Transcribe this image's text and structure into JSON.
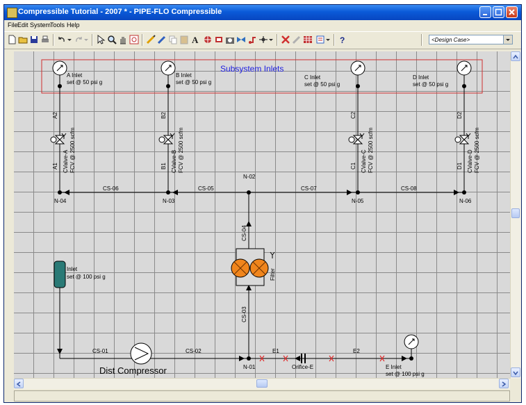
{
  "window": {
    "title": "Compressible Tutorial - 2007 * - PIPE-FLO Compressible"
  },
  "menu": {
    "items": [
      "File",
      "Edit",
      "System",
      "Tools",
      "Help"
    ]
  },
  "toolbar": {
    "design_case": "<Design Case>"
  },
  "diagram": {
    "group_title": "Subsystem Inlets",
    "inlets": [
      {
        "name": "A Inlet",
        "setpoint": "set @ 50 psi g"
      },
      {
        "name": "B Inlet",
        "setpoint": "set @ 50 psi g"
      },
      {
        "name": "C Inlet",
        "setpoint": "set @ 50 psi g"
      },
      {
        "name": "D Inlet",
        "setpoint": "set @ 50 psi g"
      }
    ],
    "valves": [
      {
        "upper_pipe": "A2",
        "lower_pipe": "A1",
        "name": "CValve-A",
        "setting": "FCV @ 2500 scfm"
      },
      {
        "upper_pipe": "B2",
        "lower_pipe": "B1",
        "name": "CValve-B",
        "setting": "FCV @ 2500 scfm"
      },
      {
        "upper_pipe": "C2",
        "lower_pipe": "C1",
        "name": "CValve-C",
        "setting": "FCV @ 2500 scfm"
      },
      {
        "upper_pipe": "D2",
        "lower_pipe": "D1",
        "name": "CValve-D",
        "setting": "FCV @ 2500 scfm"
      }
    ],
    "nodes": [
      "N-04",
      "N-03",
      "N-02",
      "N-05",
      "N-06",
      "N-01"
    ],
    "pipes": [
      "CS-06",
      "CS-05",
      "CS-07",
      "CS-08",
      "CS-04",
      "CS-03",
      "CS-01",
      "CS-02",
      "E1",
      "E2"
    ],
    "filter_label": "Filter",
    "source": {
      "name": "Inlet",
      "setpoint": "set @ 100 psi g"
    },
    "compressor_label": "Dist Compressor",
    "orifice_label": "Orifice-E",
    "outlet": {
      "name": "E Inlet",
      "setpoint": "set @ 100 psi g"
    }
  },
  "colors": {
    "grid_bg": "#d9d9d9",
    "title_blue": "#2020e0",
    "inlet_box": "#d03030",
    "filter": "#f0851c",
    "tank": "#2a7a76"
  }
}
